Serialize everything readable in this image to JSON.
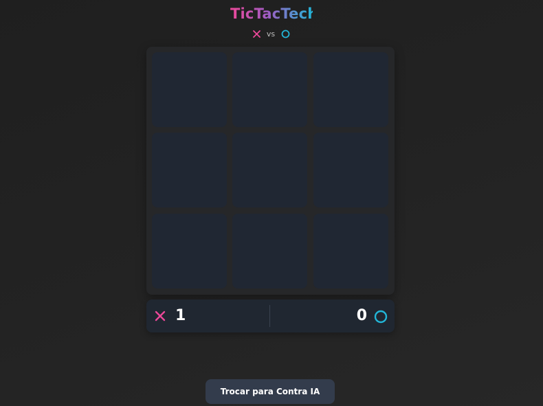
{
  "app": {
    "title": "TicTacTech",
    "vs_label": "vs"
  },
  "players": {
    "x": {
      "symbol_icon": "x-icon",
      "color": "#ec4899"
    },
    "o": {
      "symbol_icon": "o-circle-icon",
      "color": "#22b6d8"
    }
  },
  "board": {
    "cells": [
      "",
      "",
      "",
      "",
      "",
      "",
      "",
      "",
      ""
    ]
  },
  "score": {
    "x": "1",
    "o": "0"
  },
  "buttons": {
    "switch_mode_label": "Trocar para Contra IA"
  },
  "colors": {
    "background": "#222222",
    "cell": "#202733",
    "button": "#333c4c"
  }
}
